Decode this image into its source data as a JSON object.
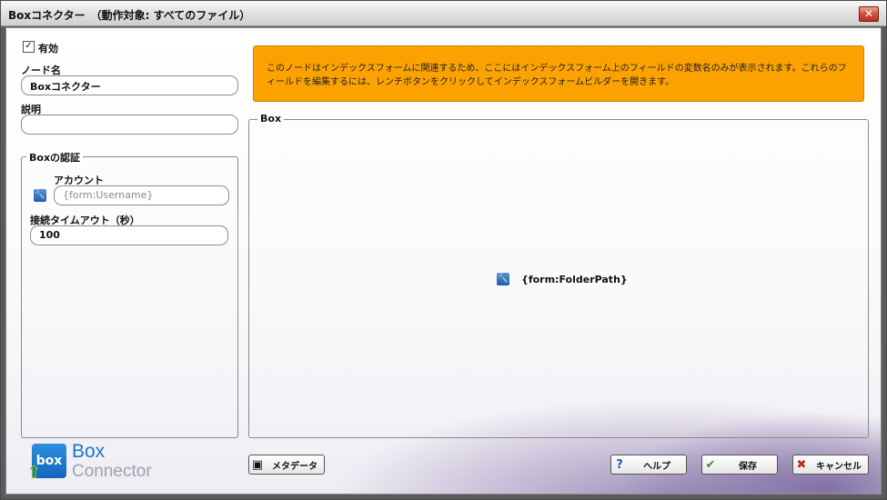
{
  "window": {
    "title": "Boxコネクター　（動作対象: すべてのファイル）",
    "close_glyph": "✕"
  },
  "enabled": {
    "label": "有効",
    "checked": true,
    "check_glyph": "✓"
  },
  "node_name": {
    "label": "ノード名",
    "value": "Boxコネクター"
  },
  "description": {
    "label": "説明",
    "value": ""
  },
  "auth_group": {
    "legend": "Boxの認証",
    "account_label": "アカウント",
    "account_placeholder": "{form:Username}",
    "timeout_label": "接続タイムアウト（秒）",
    "timeout_value": "100"
  },
  "banner": {
    "text": "このノードはインデックスフォームに関連するため、ここにはインデックスフォーム上のフィールドの変数名のみが表示されます。これらのフィールドを編集するには、レンチボタンをクリックしてインデックスフォームビルダーを開きます。",
    "color": "#fca200"
  },
  "box_group": {
    "legend": "Box",
    "folder_variable": "{form:FolderPath}"
  },
  "buttons": {
    "metadata": "メタデータ",
    "help": "ヘルプ",
    "save": "保存",
    "cancel": "キャンセル"
  },
  "icons": {
    "wrench": "wrench-icon",
    "help": "help-icon",
    "save": "checkmark-icon",
    "cancel": "cancel-x-icon",
    "metadata": "film-icon"
  },
  "logo": {
    "mark": "box",
    "line1": "Box",
    "line2": "Connector"
  }
}
